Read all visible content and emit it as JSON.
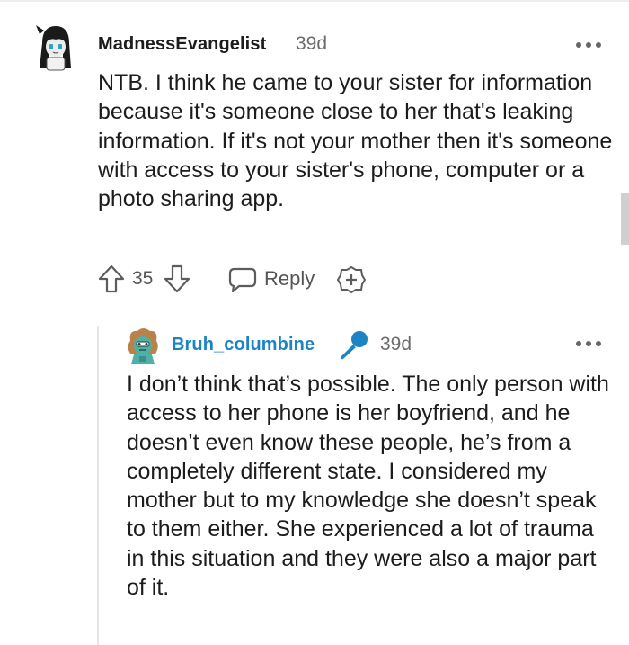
{
  "comment": {
    "username": "MadnessEvangelist",
    "time": "39d",
    "body": "NTB. I think he came to your sister for information because it's someone close to her that's leaking information. If it's not your mother then it's someone with access to your sister's phone, computer or a photo sharing app.",
    "score": "35",
    "reply_label": "Reply",
    "icons": {
      "more": "more-options-icon",
      "upvote": "upvote-arrow-icon",
      "downvote": "downvote-arrow-icon",
      "reply": "speech-bubble-icon",
      "award": "award-plus-icon"
    }
  },
  "reply": {
    "username": "Bruh_columbine",
    "time": "39d",
    "badge_icon": "microphone-icon",
    "body": "I don’t think that’s possible. The only person with access to her phone is her boyfriend, and he doesn’t even know these people, he’s from a completely different state. I considered my mother but to my knowledge she doesn’t speak to them either. She experienced a lot of trauma in this situation and they were also a major part of it."
  },
  "colors": {
    "text": "#1c1c1c",
    "muted": "#6b6b6b",
    "op_username": "#1d84c4",
    "mic_badge": "#1d84c4",
    "icon_gray": "#5c5c5c"
  }
}
